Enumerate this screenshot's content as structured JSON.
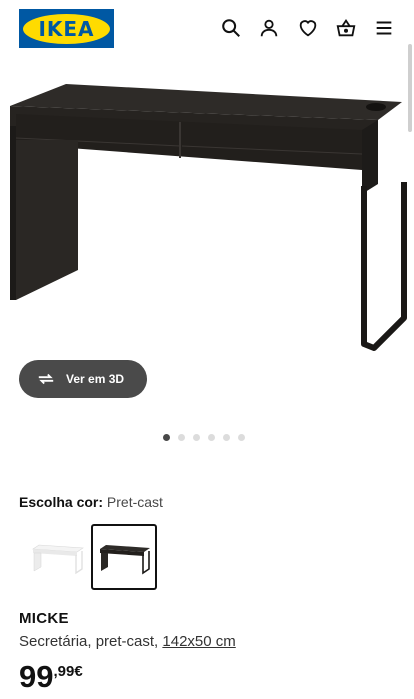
{
  "header": {
    "logo_text": "IKEA",
    "icons": [
      "search-icon",
      "user-icon",
      "heart-icon",
      "basket-icon",
      "menu-icon"
    ]
  },
  "gallery": {
    "view3d_label": "Ver em 3D",
    "total_images": 6,
    "active_index": 0
  },
  "color": {
    "label": "Escolha cor:",
    "value": "Pret-cast"
  },
  "product": {
    "name": "MICKE",
    "desc_prefix": "Secretária, pret-cast, ",
    "dimensions": "142x50 cm",
    "price_int": "99",
    "price_dec": ",99€"
  },
  "colors": {
    "brand_blue": "#0058a3",
    "brand_yellow": "#ffdb00",
    "desk_dark": "#2b2825"
  }
}
